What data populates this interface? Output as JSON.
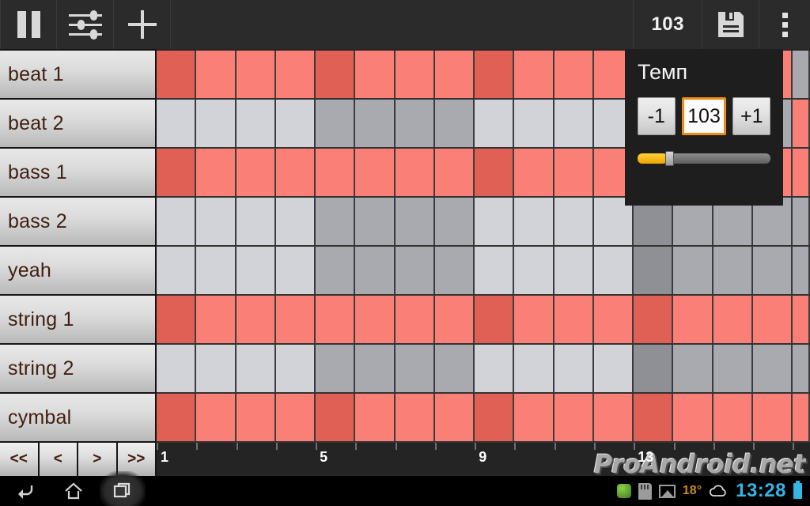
{
  "toolbar": {
    "pause_label": "pause-icon",
    "mixer_label": "sliders-icon",
    "add_label": "plus-icon",
    "tempo_value": "103",
    "save_label": "save-icon",
    "overflow_label": "overflow-menu-icon"
  },
  "tempo_popup": {
    "title": "Темп",
    "decrement": "-1",
    "value": "103",
    "increment": "+1",
    "accent_color": "#ef8c12",
    "slider_fill_color": "#f0a400",
    "slider_percent": 22
  },
  "tracks": [
    {
      "label": "beat 1"
    },
    {
      "label": "beat 2"
    },
    {
      "label": "bass 1"
    },
    {
      "label": "bass 2"
    },
    {
      "label": "yeah"
    },
    {
      "label": "string 1"
    },
    {
      "label": "string 2"
    },
    {
      "label": "cymbal"
    }
  ],
  "transport": {
    "rewind_all": "<<",
    "rewind": "<",
    "forward": ">",
    "forward_all": ">>"
  },
  "ruler": {
    "labels": [
      "1",
      "5",
      "9",
      "13"
    ],
    "label_columns": [
      1,
      5,
      9,
      13
    ],
    "total_columns": 16
  },
  "watermark": "ProAndroid.net",
  "colors": {
    "active": "#fa8077",
    "active_accent": "#e06055",
    "active_accent_strong": "#c9766e",
    "inactive_light": "#d2d2d9",
    "inactive_dark": "#a9a9b0",
    "inactive_darker": "#8f8f96",
    "toolbar_bg": "#2b2b2b",
    "popup_bg": "#1e1e1e"
  },
  "grid": {
    "columns": 16,
    "rows": [
      {
        "track": "beat 1",
        "cells": [
          "aa",
          "a",
          "a",
          "a",
          "aa",
          "a",
          "a",
          "a",
          "aa",
          "a",
          "a",
          "a",
          "a",
          "a",
          "a",
          "a"
        ]
      },
      {
        "track": "beat 2",
        "cells": [
          "l",
          "l",
          "l",
          "l",
          "d",
          "d",
          "d",
          "d",
          "l",
          "l",
          "l",
          "l",
          "dd",
          "d",
          "d",
          "d"
        ]
      },
      {
        "track": "bass 1",
        "cells": [
          "aa",
          "a",
          "a",
          "a",
          "a",
          "a",
          "a",
          "a",
          "aa",
          "a",
          "a",
          "a",
          "a",
          "a",
          "a",
          "a"
        ]
      },
      {
        "track": "bass 2",
        "cells": [
          "l",
          "l",
          "l",
          "l",
          "d",
          "d",
          "d",
          "d",
          "l",
          "l",
          "l",
          "l",
          "dd",
          "d",
          "d",
          "d"
        ]
      },
      {
        "track": "yeah",
        "cells": [
          "l",
          "l",
          "l",
          "l",
          "d",
          "d",
          "d",
          "d",
          "l",
          "l",
          "l",
          "l",
          "dd",
          "d",
          "d",
          "d"
        ]
      },
      {
        "track": "string 1",
        "cells": [
          "aa",
          "a",
          "a",
          "a",
          "a",
          "a",
          "a",
          "a",
          "aa",
          "a",
          "a",
          "a",
          "aa",
          "a",
          "a",
          "a"
        ]
      },
      {
        "track": "string 2",
        "cells": [
          "l",
          "l",
          "l",
          "l",
          "d",
          "d",
          "d",
          "d",
          "l",
          "l",
          "l",
          "l",
          "dd",
          "d",
          "d",
          "d"
        ]
      },
      {
        "track": "cymbal",
        "cells": [
          "aa",
          "a",
          "a",
          "a",
          "aa",
          "a",
          "a",
          "a",
          "aa",
          "a",
          "a",
          "a",
          "aa",
          "a",
          "a",
          "a"
        ]
      }
    ],
    "edge_column": [
      "d",
      "a",
      "a",
      "d",
      "d",
      "a",
      "d",
      "a"
    ]
  },
  "system_bar": {
    "back": "back-icon",
    "home": "home-icon",
    "recents": "recents-icon",
    "temperature": "18°",
    "clock": "13:28",
    "weather": "cloud-icon",
    "sdcard": "sd-card-icon",
    "gallery": "image-icon",
    "app": "green-app-icon",
    "battery": "battery-icon"
  }
}
